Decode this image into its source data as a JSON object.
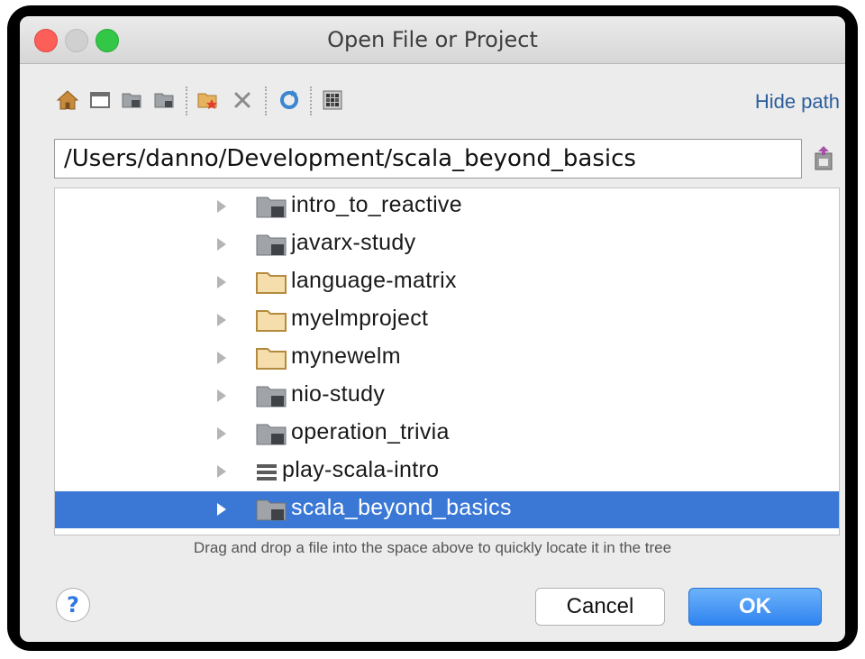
{
  "window": {
    "title": "Open File or Project"
  },
  "toolbar": {
    "icons": [
      "home-icon",
      "desktop-icon",
      "project-folder-icon",
      "module-folder-icon",
      "new-folder-icon",
      "delete-icon",
      "refresh-icon",
      "show-hidden-files-icon"
    ],
    "hide_path_label": "Hide path"
  },
  "path": {
    "value": "/Users/danno/Development/scala_beyond_basics"
  },
  "tree": {
    "items": [
      {
        "label": "intro_to_reactive",
        "icon": "module-folder-icon"
      },
      {
        "label": "javarx-study",
        "icon": "module-folder-icon"
      },
      {
        "label": "language-matrix",
        "icon": "folder-icon"
      },
      {
        "label": "myelmproject",
        "icon": "folder-icon"
      },
      {
        "label": "mynewelm",
        "icon": "folder-icon"
      },
      {
        "label": "nio-study",
        "icon": "module-folder-icon"
      },
      {
        "label": "operation_trivia",
        "icon": "module-folder-icon"
      },
      {
        "label": "play-scala-intro",
        "icon": "list-icon"
      },
      {
        "label": "scala_beyond_basics",
        "icon": "module-folder-icon",
        "selected": true
      }
    ]
  },
  "hint": "Drag and drop a file into the space above to quickly locate it in the tree",
  "buttons": {
    "help": "?",
    "cancel": "Cancel",
    "ok": "OK"
  },
  "colors": {
    "selection": "#3b78d6",
    "ok_button": "#2f83f0",
    "link": "#2c5e9c"
  }
}
